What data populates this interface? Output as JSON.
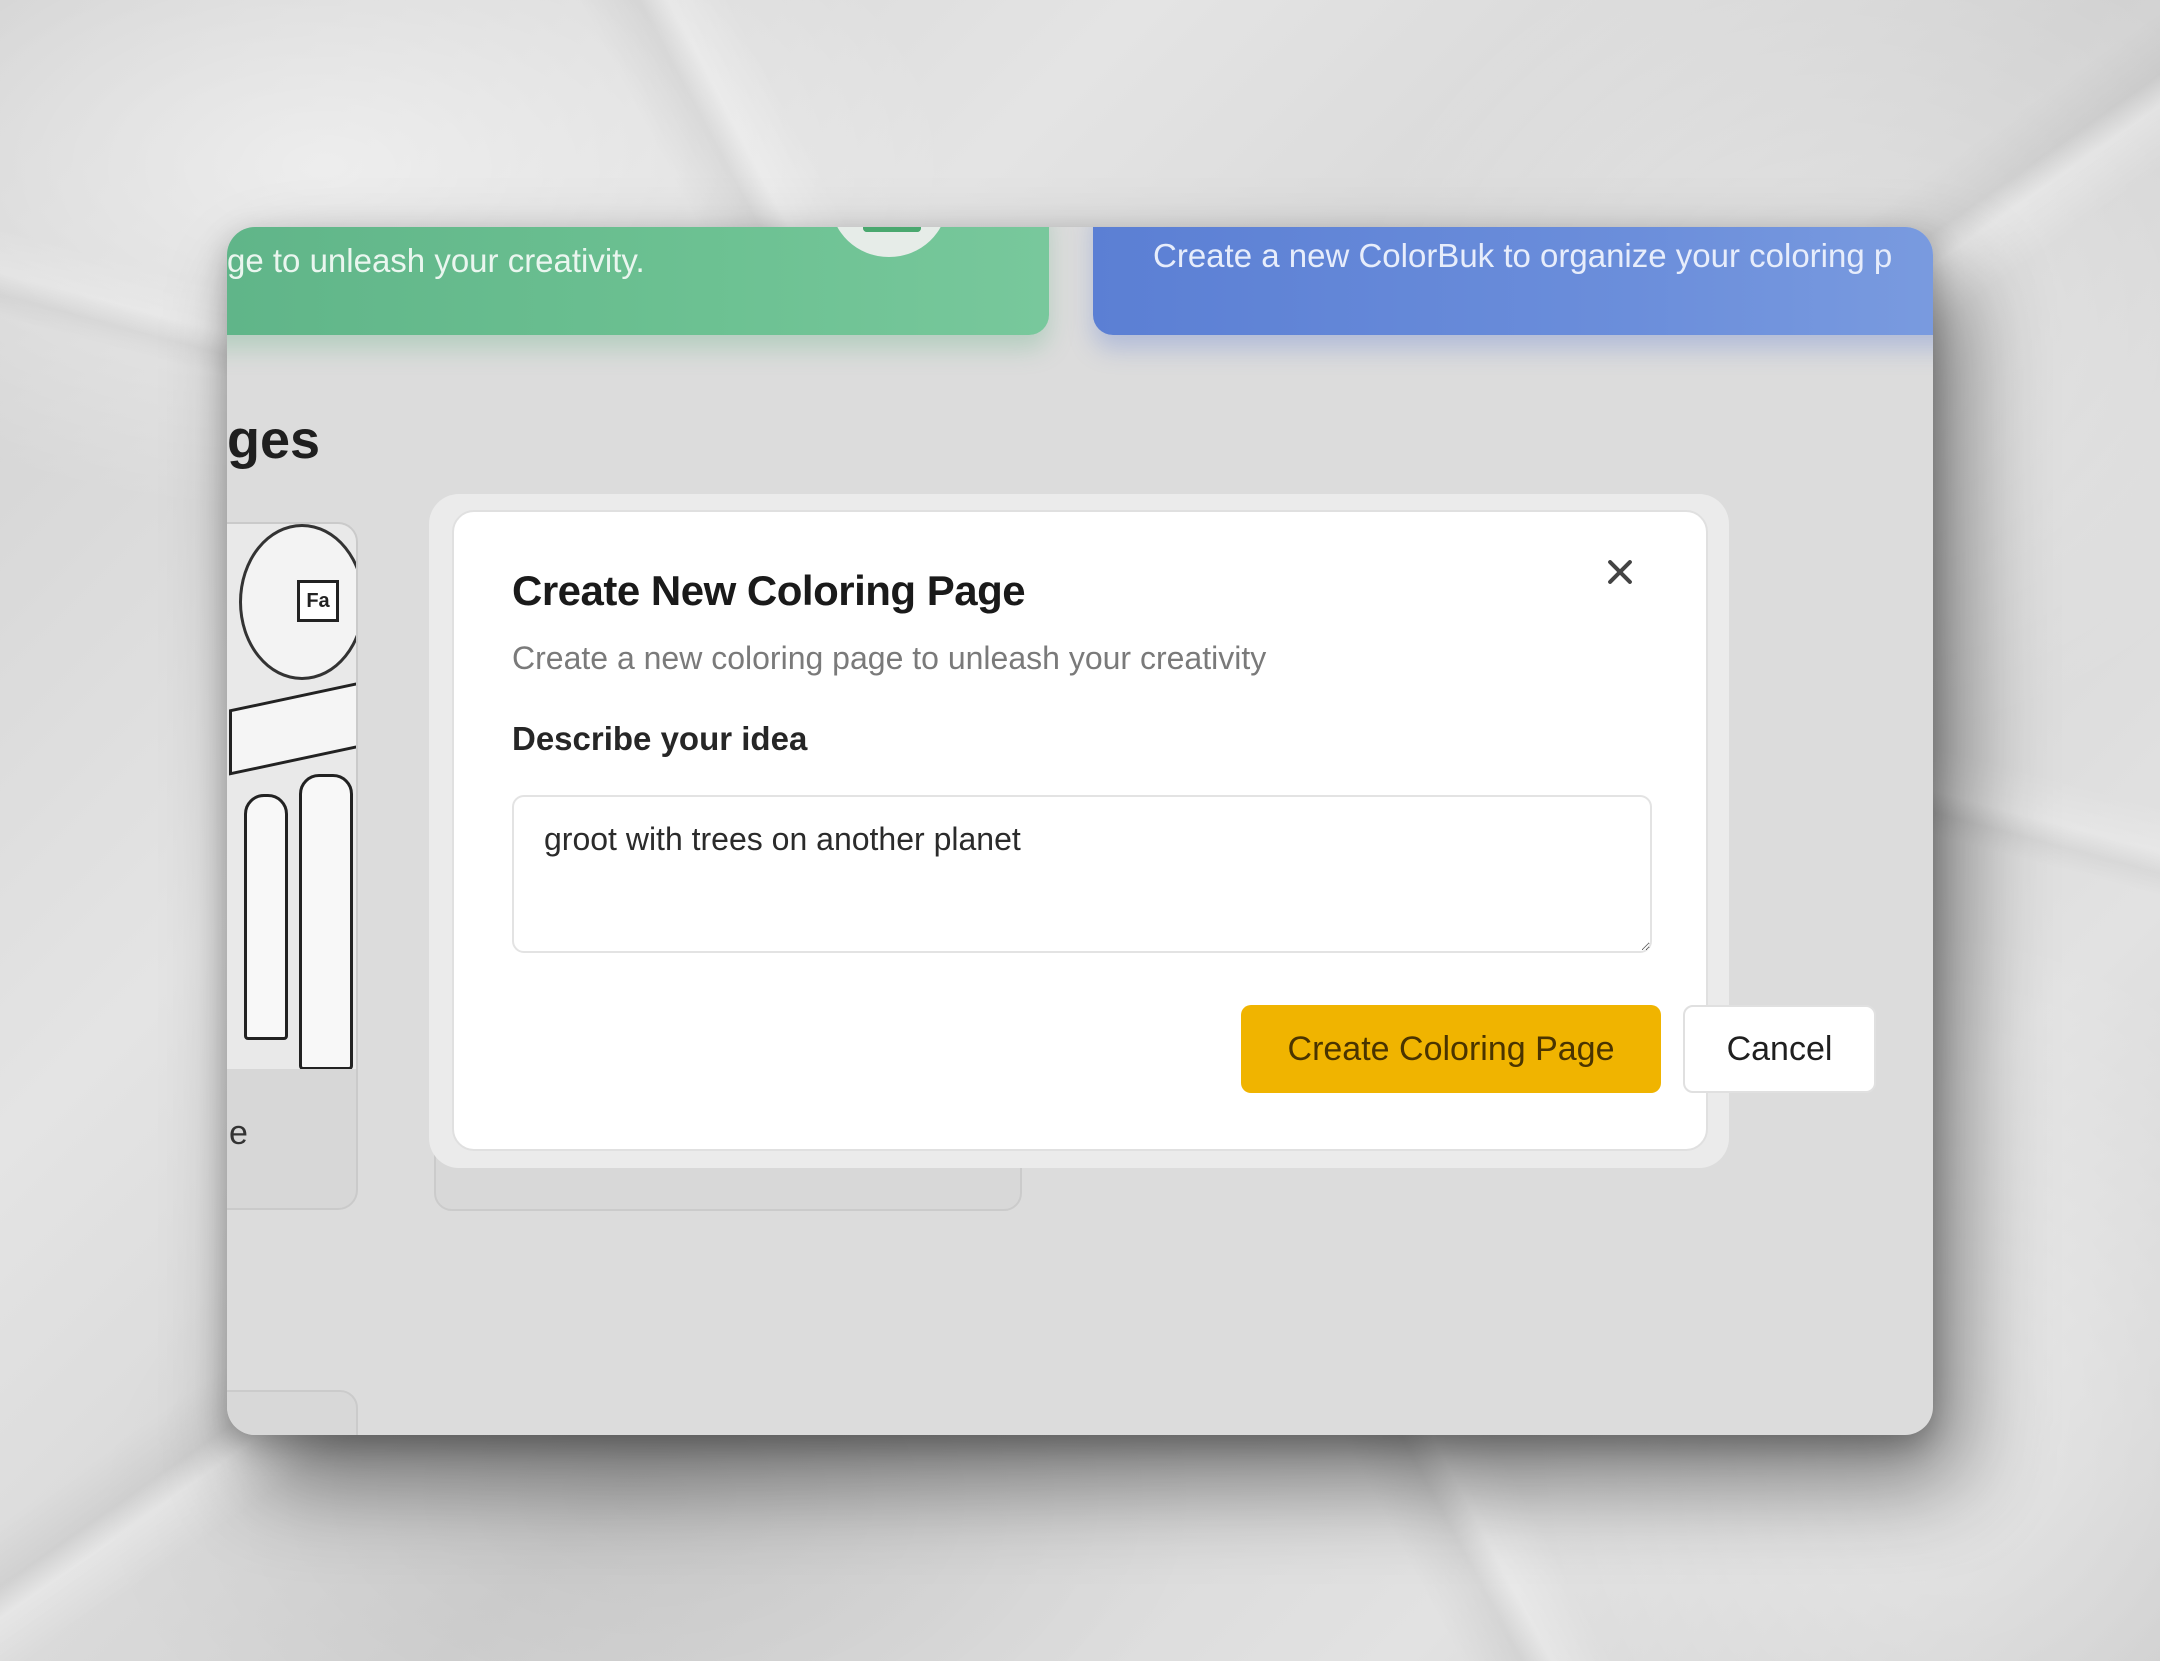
{
  "background": {
    "green_card": {
      "text": "ge to unleash your creativity.",
      "icon": "image-plus-icon"
    },
    "blue_card": {
      "text": "Create a new ColorBuk to organize your coloring p"
    },
    "section_heading": "ges",
    "thumbnail": {
      "sign_text": "Fa",
      "caption": "e"
    }
  },
  "modal": {
    "title": "Create New Coloring Page",
    "subtitle": "Create a new coloring page to unleash your creativity",
    "field_label": "Describe your idea",
    "textarea_value": "groot with trees on another planet",
    "primary_label": "Create Coloring Page",
    "secondary_label": "Cancel",
    "close_icon": "close-icon"
  },
  "colors": {
    "primary_button": "#f0b400",
    "green_card": "#6cc192",
    "blue_card": "#6b8edb"
  }
}
